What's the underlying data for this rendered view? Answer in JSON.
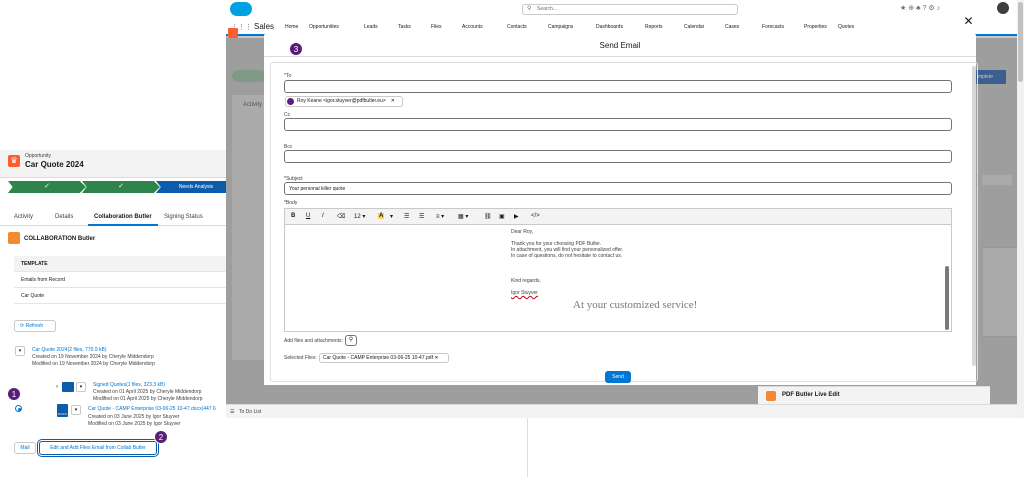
{
  "opportunity": {
    "type_label": "Opportunity",
    "title": "Car Quote 2024",
    "path_step_current": "Needs Analysis",
    "check1": "✓",
    "check2": "✓"
  },
  "tabs": [
    "Activity",
    "Details",
    "Collaboration Butler",
    "Signing Status"
  ],
  "collab": {
    "title": "COLLABORATION Butler",
    "table_header": "TEMPLATE",
    "rows": [
      "Emails from Record",
      "Car Quote"
    ],
    "refresh_label": "Refresh",
    "folder1": {
      "name": "Car Quote 2024(2 files, 770.9 kB)",
      "created": "Created on 19 November 2024 by Cheryle Middendorp",
      "modified": "Modified on 19 November 2024 by Cheryle Middendorp"
    },
    "folder2": {
      "name": "Signed Quotes(1 files, 323.3 kB)",
      "created": "Created on 01 April 2025 by Cheryle Middendorp",
      "modified": "Modified on 01 April 2025 by Cheryle Middendorp"
    },
    "file": {
      "name": "Car Quote - CAMP Enterprise 03-06-25 10-47.docx(447.6",
      "created": "Created on 03 June 2025 by Igor Stuyver",
      "modified": "Modified on 03 June 2025 by Igor Stuyver",
      "icon_text": "DOCX"
    },
    "mail_label": "Mail",
    "edit_label": "Edit and Add Files Email from Collab Butler"
  },
  "badges": {
    "b1": "1",
    "b2": "2",
    "b3": "3"
  },
  "salesforce": {
    "search_placeholder": "Search...",
    "app_name": "Sales",
    "nav": [
      "Home",
      "Opportunities",
      "Leads",
      "Tasks",
      "Files",
      "Accounts",
      "Contacts",
      "Campaigns",
      "Dashboards",
      "Reports",
      "Calendar",
      "Cases",
      "Forecasts",
      "Properties",
      "Quotes"
    ],
    "live_edit": "PDF Butler Live Edit",
    "todo": "To Do List",
    "right_btn": "mplete"
  },
  "modal": {
    "title": "Send Email",
    "to_label": "To",
    "recipient": "Roy Keane <igor.stuyver@pdfbutler.eu>",
    "cc_label": "Cc",
    "bcc_label": "Bcc",
    "subject_label": "Subject",
    "subject_value": "Your personal killer quote",
    "body_label": "Body",
    "font_size": "12",
    "body": {
      "greeting": "Dear Roy,",
      "line1": "Thank you for your choosing PDF Butler.",
      "line2": "In attachment, you will find your personalized offer.",
      "line3": "In case of questions, do not hesitate to contact us.",
      "closing": "Kind regards,",
      "signature_name": "Igor Stuyver",
      "signature_tag": "At your customized service!"
    },
    "attach_label": "Add files and attachments:",
    "selected_label": "Selected Files:",
    "selected_file": "Car Quote - CAMP Enterprise 03-06-25 10-47.pdf",
    "send_label": "Send"
  },
  "colors": {
    "accent": "#0176d3",
    "badge": "#5a1d7a",
    "path_complete": "#2e844a",
    "brand_orange": "#ff5d2d"
  }
}
